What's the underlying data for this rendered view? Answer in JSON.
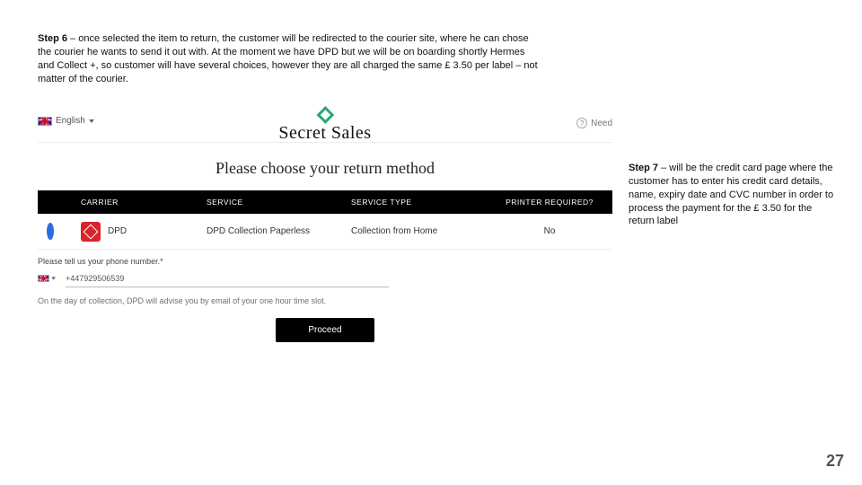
{
  "step6": {
    "label": "Step 6",
    "text": " – once selected the item to return, the customer will be redirected to the courier site, where he can chose the courier he wants to send it out with. At the moment we have DPD but we will be on boarding shortly Hermes and Collect +, so customer will have several choices, however they are all charged the same £ 3.50 per label – not matter of the courier."
  },
  "step7": {
    "label": "Step 7",
    "text": " – will be the credit card page where the customer has to enter his credit card details, name, expiry date and CVC number in order to process the payment for the £ 3.50 for the return label"
  },
  "screenshot": {
    "language_label": "English",
    "brand": "Secret Sales",
    "help_label": "Need",
    "heading": "Please choose your return method",
    "columns": {
      "carrier": "CARRIER",
      "service": "SERVICE",
      "service_type": "SERVICE TYPE",
      "printer": "PRINTER REQUIRED?"
    },
    "row": {
      "carrier_name": "DPD",
      "service": "DPD Collection Paperless",
      "service_type": "Collection from Home",
      "printer": "No"
    },
    "phone_label": "Please tell us your phone number.*",
    "phone_value": "+447929506539",
    "advise_text": "On the day of collection, DPD will advise you by email of your one hour time slot.",
    "proceed_label": "Proceed"
  },
  "page_number": "27"
}
